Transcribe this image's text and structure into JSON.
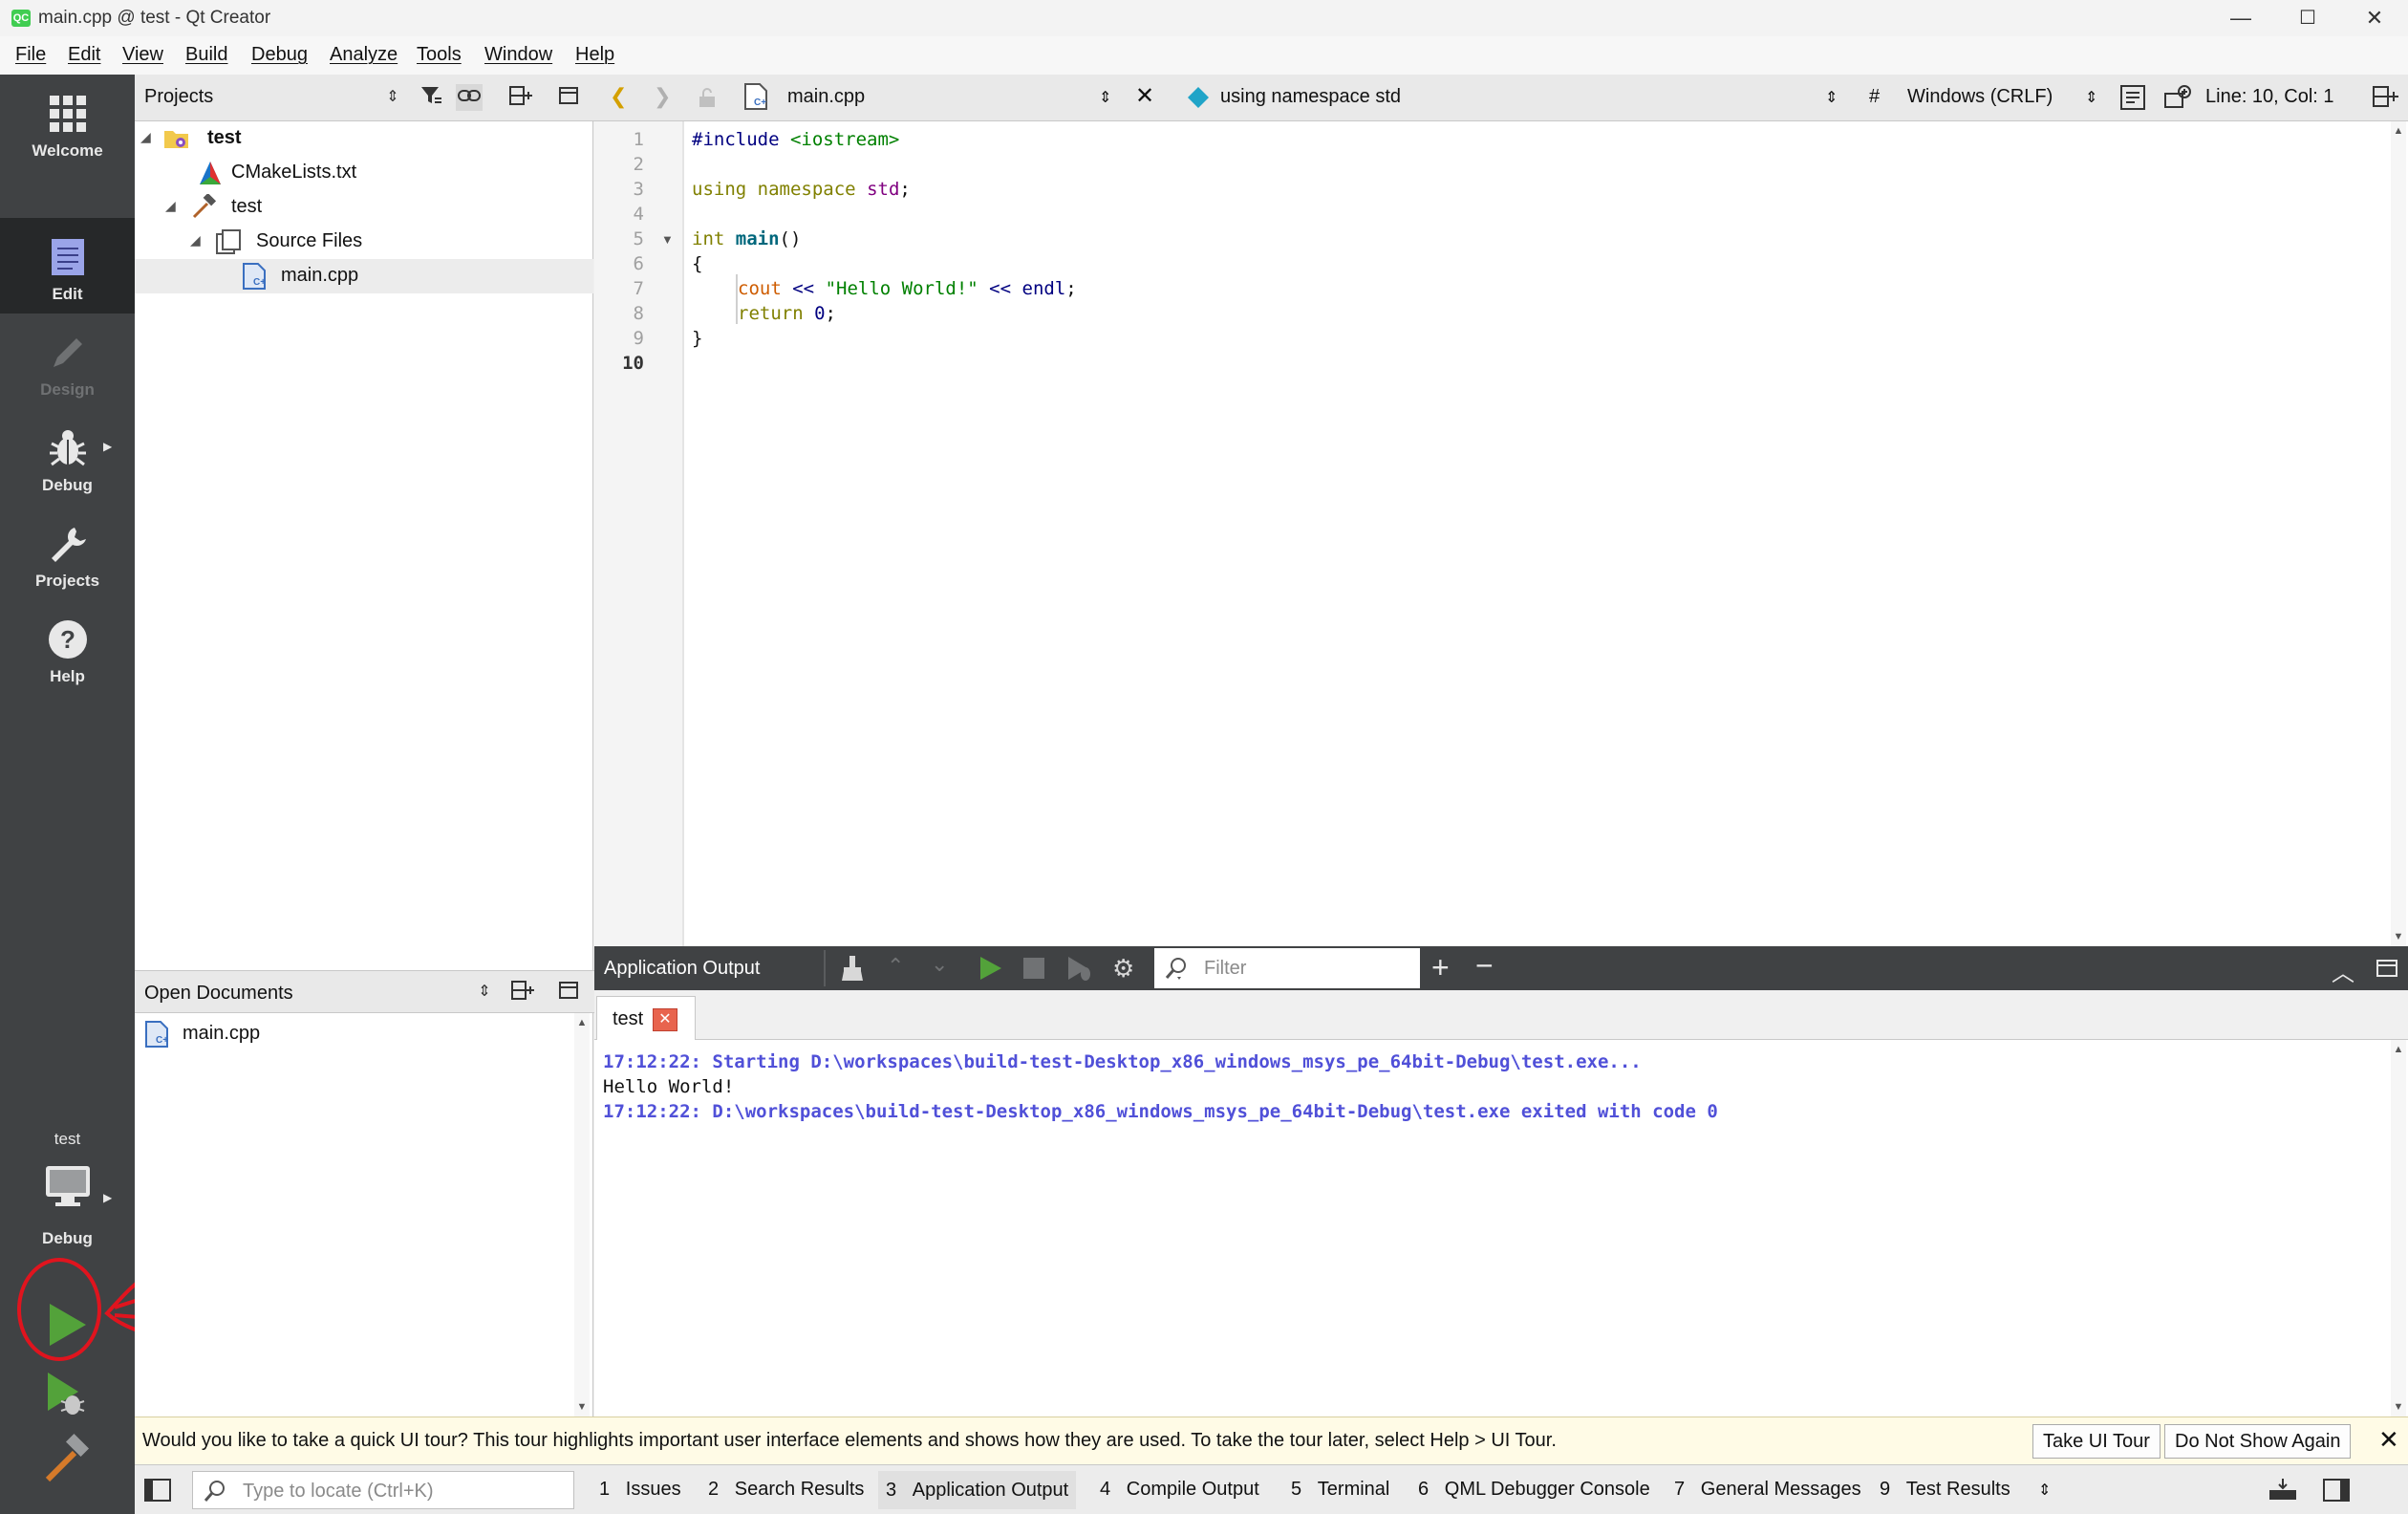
{
  "window": {
    "title": "main.cpp @ test - Qt Creator",
    "icon_text": "QC",
    "minimize": "—",
    "maximize": "☐",
    "close": "✕"
  },
  "menu": [
    "File",
    "Edit",
    "View",
    "Build",
    "Debug",
    "Analyze",
    "Tools",
    "Window",
    "Help"
  ],
  "modes": [
    {
      "label": "Welcome",
      "icon": "grid-icon"
    },
    {
      "label": "Edit",
      "icon": "document-icon",
      "active": true
    },
    {
      "label": "Design",
      "icon": "pencil-icon",
      "disabled": true
    },
    {
      "label": "Debug",
      "icon": "bug-icon"
    },
    {
      "label": "Projects",
      "icon": "wrench-icon"
    },
    {
      "label": "Help",
      "icon": "help-icon"
    }
  ],
  "kit": {
    "project": "test",
    "config": "Debug"
  },
  "projects_panel": {
    "title": "Projects",
    "tree": [
      {
        "label": "test",
        "level": 0,
        "expanded": true,
        "bold": true,
        "icon": "project-folder-icon"
      },
      {
        "label": "CMakeLists.txt",
        "level": 1,
        "icon": "cmake-icon"
      },
      {
        "label": "test",
        "level": 1,
        "expanded": true,
        "icon": "hammer-icon"
      },
      {
        "label": "Source Files",
        "level": 2,
        "expanded": true,
        "icon": "source-folder-icon"
      },
      {
        "label": "main.cpp",
        "level": 3,
        "icon": "cpp-file-icon",
        "selected": true
      }
    ]
  },
  "editor_toolbar": {
    "file": "main.cpp",
    "symbol": "using namespace std",
    "hash": "#",
    "line_ending": "Windows (CRLF)",
    "position": "Line: 10, Col: 1"
  },
  "editor": {
    "line_numbers": [
      "1",
      "2",
      "3",
      "4",
      "5",
      "6",
      "7",
      "8",
      "9",
      "10"
    ],
    "current_line": "10",
    "code": {
      "l1_directive": "#include",
      "l1_header": "<iostream>",
      "l3_using": "using",
      "l3_namespace": "namespace",
      "l3_std": "std",
      "l3_semi": ";",
      "l5_int": "int",
      "l5_main": "main",
      "l5_parens": "()",
      "l6": "{",
      "l7_cout": "cout",
      "l7_op1": "<<",
      "l7_str": "\"Hello World!\"",
      "l7_op2": "<<",
      "l7_endl": "endl",
      "l7_semi": ";",
      "l8_return": "return",
      "l8_zero": "0",
      "l8_semi": ";",
      "l9": "}"
    }
  },
  "open_documents": {
    "title": "Open Documents",
    "items": [
      "main.cpp"
    ]
  },
  "output_pane": {
    "title": "Application Output",
    "filter_placeholder": "Filter",
    "tab": "test",
    "lines": [
      "17:12:22: Starting D:\\workspaces\\build-test-Desktop_x86_windows_msys_pe_64bit-Debug\\test.exe...",
      "Hello World!",
      "17:12:22: D:\\workspaces\\build-test-Desktop_x86_windows_msys_pe_64bit-Debug\\test.exe exited with code 0"
    ]
  },
  "infobar": {
    "message": "Would you like to take a quick UI tour? This tour highlights important user interface elements and shows how they are used. To take the tour later, select Help > UI Tour.",
    "take_tour": "Take UI Tour",
    "dont_show": "Do Not Show Again"
  },
  "statusbar": {
    "locator_placeholder": "Type to locate (Ctrl+K)",
    "tabs": [
      {
        "num": "1",
        "label": "Issues"
      },
      {
        "num": "2",
        "label": "Search Results"
      },
      {
        "num": "3",
        "label": "Application Output",
        "active": true
      },
      {
        "num": "4",
        "label": "Compile Output"
      },
      {
        "num": "5",
        "label": "Terminal"
      },
      {
        "num": "6",
        "label": "QML Debugger Console"
      },
      {
        "num": "7",
        "label": "General Messages"
      },
      {
        "num": "9",
        "label": "Test Results"
      }
    ]
  },
  "colors": {
    "modebar": "#404244",
    "run_green": "#53a23a",
    "annotation_red": "#e0141e",
    "output_blue": "#5050d8"
  }
}
